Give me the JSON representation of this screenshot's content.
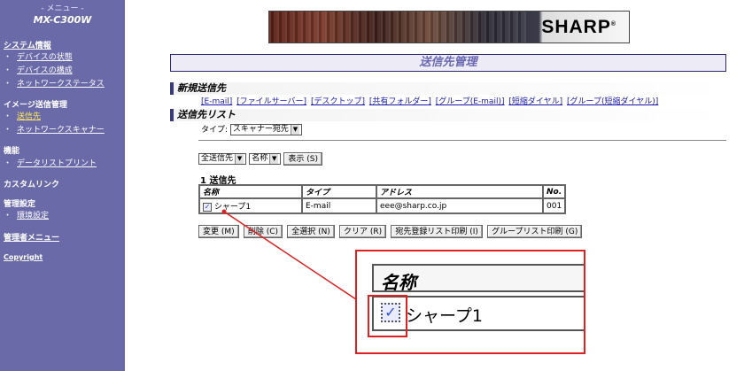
{
  "sidebar": {
    "menu_label": "- メニュー -",
    "model": "MX-C300W",
    "system_info": "システム情報",
    "system_items": [
      "デバイスの状態",
      "デバイスの構成",
      "ネットワークステータス"
    ],
    "image_send": "イメージ送信管理",
    "image_send_items": [
      "送信先",
      "ネットワークスキャナー"
    ],
    "functions": "機能",
    "function_items": [
      "データリストプリント"
    ],
    "custom_links": "カスタムリンク",
    "admin_settings": "管理設定",
    "admin_items": [
      "環境設定"
    ],
    "admin_menu": "管理者メニュー",
    "copyright": "Copyright"
  },
  "logo": {
    "brand": "SHARP",
    "mark": "®"
  },
  "page_title": "送信先管理",
  "new_destination": {
    "title": "新規送信先",
    "links": [
      "[E-mail]",
      "[ファイルサーバー]",
      "[デスクトップ]",
      "[共有フォルダー]",
      "[グループ(E-mail)]",
      "[短縮ダイヤル]",
      "[グループ(短縮ダイヤル)]"
    ]
  },
  "dest_list": {
    "title": "送信先リスト",
    "type_label": "タイプ:",
    "type_value": "スキャナー宛先",
    "filter_value": "全送信先",
    "sort_value": "名称",
    "show_button": "表示 (S)",
    "count_label": "1 送信先",
    "columns": [
      "名称",
      "タイプ",
      "アドレス",
      "No."
    ],
    "rows": [
      {
        "name": "シャープ1",
        "type": "E-mail",
        "address": "eee@sharp.co.jp",
        "no": "001",
        "checked": true
      }
    ],
    "buttons": [
      "変更 (M)",
      "削除 (C)",
      "全選択 (N)",
      "クリア (R)",
      "宛先登録リスト印刷 (I)",
      "グループリスト印刷 (G)"
    ]
  },
  "zoom": {
    "header": "名称",
    "name": "シャープ1"
  },
  "colors": {
    "sidebar_bg": "#6b6aa8",
    "current_item": "#ffe95a",
    "callout_red": "#e02020",
    "title_text": "#6a68b0"
  }
}
